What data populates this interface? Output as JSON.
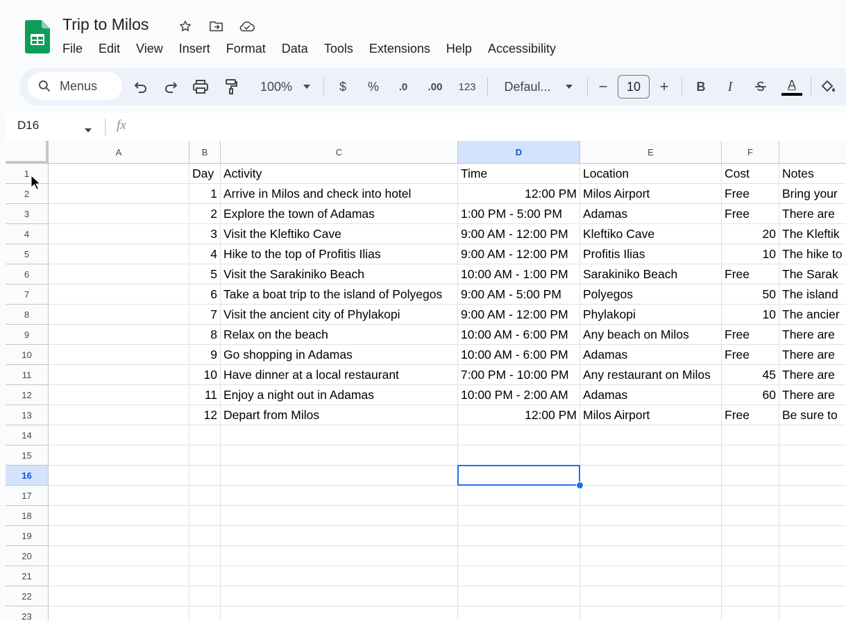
{
  "app": {
    "title": "Trip to Milos",
    "menu": [
      "File",
      "Edit",
      "View",
      "Insert",
      "Format",
      "Data",
      "Tools",
      "Extensions",
      "Help",
      "Accessibility"
    ]
  },
  "toolbar": {
    "search_label": "Menus",
    "zoom": "100%",
    "currency": "$",
    "percent": "%",
    "dec_decrease": ".0",
    "dec_increase": ".00",
    "number_format": "123",
    "font": "Defaul...",
    "font_size": "10",
    "minus": "−",
    "plus": "+",
    "bold": "B",
    "italic": "I",
    "text_color": "A"
  },
  "formula_bar": {
    "name_box": "D16",
    "fx": "fx",
    "value": ""
  },
  "sheet": {
    "columns": [
      "A",
      "B",
      "C",
      "D",
      "E",
      "F",
      ""
    ],
    "selected_column": "D",
    "selected_row": 16,
    "rows": [
      {
        "n": "1",
        "cells": [
          "",
          "Day",
          "Activity",
          "Time",
          "Location",
          "Cost",
          "Notes"
        ]
      },
      {
        "n": "2",
        "cells": [
          "",
          "1",
          "Arrive in Milos and check into hotel",
          "12:00 PM",
          "Milos Airport",
          "Free",
          "Bring your"
        ]
      },
      {
        "n": "3",
        "cells": [
          "",
          "2",
          "Explore the town of Adamas",
          "1:00 PM - 5:00 PM",
          "Adamas",
          "Free",
          "There are"
        ]
      },
      {
        "n": "4",
        "cells": [
          "",
          "3",
          "Visit the Kleftiko Cave",
          "9:00 AM - 12:00 PM",
          "Kleftiko Cave",
          "20",
          "The Kleftik"
        ]
      },
      {
        "n": "5",
        "cells": [
          "",
          "4",
          "Hike to the top of Profitis Ilias",
          "9:00 AM - 12:00 PM",
          "Profitis Ilias",
          "10",
          "The hike to"
        ]
      },
      {
        "n": "6",
        "cells": [
          "",
          "5",
          "Visit the Sarakiniko Beach",
          "10:00 AM - 1:00 PM",
          "Sarakiniko Beach",
          "Free",
          "The Sarak"
        ]
      },
      {
        "n": "7",
        "cells": [
          "",
          "6",
          "Take a boat trip to the island of Polyegos",
          "9:00 AM - 5:00 PM",
          "Polyegos",
          "50",
          "The island"
        ]
      },
      {
        "n": "8",
        "cells": [
          "",
          "7",
          "Visit the ancient city of Phylakopi",
          "9:00 AM - 12:00 PM",
          "Phylakopi",
          "10",
          "The ancier"
        ]
      },
      {
        "n": "9",
        "cells": [
          "",
          "8",
          "Relax on the beach",
          "10:00 AM - 6:00 PM",
          "Any beach on Milos",
          "Free",
          "There are"
        ]
      },
      {
        "n": "10",
        "cells": [
          "",
          "9",
          "Go shopping in Adamas",
          "10:00 AM - 6:00 PM",
          "Adamas",
          "Free",
          "There are"
        ]
      },
      {
        "n": "11",
        "cells": [
          "",
          "10",
          "Have dinner at a local restaurant",
          "7:00 PM - 10:00 PM",
          "Any restaurant on Milos",
          "45",
          "There are"
        ]
      },
      {
        "n": "12",
        "cells": [
          "",
          "11",
          "Enjoy a night out in Adamas",
          "10:00 PM - 2:00 AM",
          "Adamas",
          "60",
          "There are"
        ]
      },
      {
        "n": "13",
        "cells": [
          "",
          "12",
          "Depart from Milos",
          "12:00 PM",
          "Milos Airport",
          "Free",
          "Be sure to"
        ]
      },
      {
        "n": "14",
        "cells": [
          "",
          "",
          "",
          "",
          "",
          "",
          ""
        ]
      },
      {
        "n": "15",
        "cells": [
          "",
          "",
          "",
          "",
          "",
          "",
          ""
        ]
      },
      {
        "n": "16",
        "cells": [
          "",
          "",
          "",
          "",
          "",
          "",
          ""
        ]
      },
      {
        "n": "17",
        "cells": [
          "",
          "",
          "",
          "",
          "",
          "",
          ""
        ]
      },
      {
        "n": "18",
        "cells": [
          "",
          "",
          "",
          "",
          "",
          "",
          ""
        ]
      },
      {
        "n": "19",
        "cells": [
          "",
          "",
          "",
          "",
          "",
          "",
          ""
        ]
      },
      {
        "n": "20",
        "cells": [
          "",
          "",
          "",
          "",
          "",
          "",
          ""
        ]
      },
      {
        "n": "21",
        "cells": [
          "",
          "",
          "",
          "",
          "",
          "",
          ""
        ]
      },
      {
        "n": "22",
        "cells": [
          "",
          "",
          "",
          "",
          "",
          "",
          ""
        ]
      },
      {
        "n": "23",
        "cells": [
          "",
          "",
          "",
          "",
          "",
          "",
          ""
        ]
      }
    ]
  },
  "colors": {
    "accent": "#1a73e8",
    "sheets_green": "#0f9d58",
    "header_selected": "#d3e3fd"
  }
}
